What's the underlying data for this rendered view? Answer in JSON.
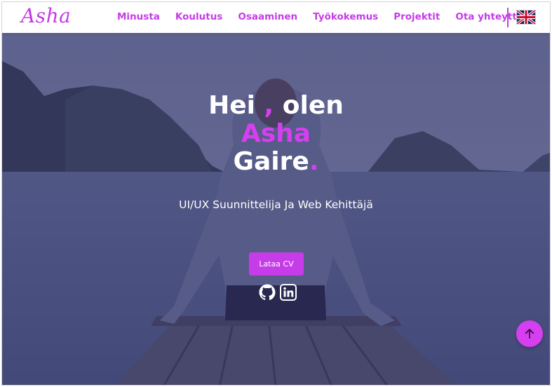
{
  "nav": {
    "logo": "Asha",
    "links": [
      "Minusta",
      "Koulutus",
      "Osaaminen",
      "Työkokemus",
      "Projektit",
      "Ota yhteyttä"
    ],
    "language_flag_icon": "uk-flag-icon"
  },
  "hero": {
    "greeting_prefix": "Hei",
    "greeting_comma": " ,",
    "greeting_suffix": " olen",
    "first_name": "Asha",
    "last_name": "Gaire",
    "last_name_dot": ".",
    "subtitle": "UI/UX Suunnittelija Ja Web Kehittäjä",
    "cv_button": "Lataa CV",
    "social_icons": [
      "github-icon",
      "linkedin-icon"
    ]
  },
  "scroll_top_icon": "arrow-up-icon",
  "colors": {
    "accent": "#c63ce8",
    "overlay": "#2c2a6e",
    "text_light": "#ffffff"
  }
}
